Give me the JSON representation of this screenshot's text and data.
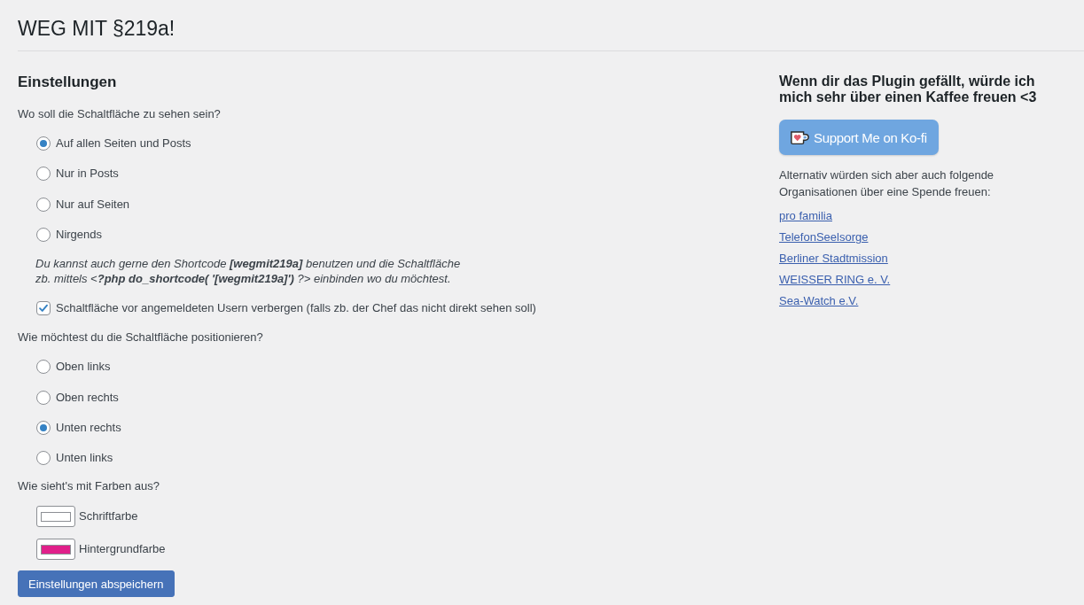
{
  "page": {
    "title": "WEG MIT §219a!"
  },
  "settings": {
    "heading": "Einstellungen",
    "visibility": {
      "question": "Wo soll die Schaltfläche zu sehen sein?",
      "options": [
        {
          "label": "Auf allen Seiten und Posts",
          "selected": true
        },
        {
          "label": "Nur in Posts",
          "selected": false
        },
        {
          "label": "Nur auf Seiten",
          "selected": false
        },
        {
          "label": "Nirgends",
          "selected": false
        }
      ],
      "note_lines": [
        "Du kannst auch gerne den Shortcode **[wegmit219a]** benutzen und die Schaltfläche",
        "zb. mittels <**?php do_shortcode( '[wegmit219a]')** ?> einbinden wo du möchtest."
      ],
      "hide_option": {
        "label": "Schaltfläche vor angemeldeten Usern verbergen (falls zb. der Chef das nicht direkt sehen soll)",
        "checked": true
      }
    },
    "position": {
      "question": "Wie möchtest du die Schaltfläche positionieren?",
      "options": [
        {
          "label": "Oben links",
          "selected": false
        },
        {
          "label": "Oben rechts",
          "selected": false
        },
        {
          "label": "Unten rechts",
          "selected": true
        },
        {
          "label": "Unten links",
          "selected": false
        }
      ]
    },
    "colors": {
      "question": "Wie sieht's mit Farben aus?",
      "fields": [
        {
          "label": "Schriftfarbe",
          "color": "#ffffff"
        },
        {
          "label": "Hintergrundfarbe",
          "color": "#e0208a"
        }
      ]
    },
    "save_button": "Einstellungen abspeichern"
  },
  "support": {
    "heading": "Wenn dir das Plugin gefällt, würde ich mich sehr über einen Kaffee freuen <3",
    "kofi_button": "Support Me on Ko-fi",
    "text": "Alternativ würden sich aber auch folgende Organisationen über eine Spende freuen:",
    "links": [
      "pro familia",
      "TelefonSeelsorge",
      "Berliner Stadtmission",
      "WEISSER RING e. V.",
      "Sea-Watch e.V."
    ]
  }
}
